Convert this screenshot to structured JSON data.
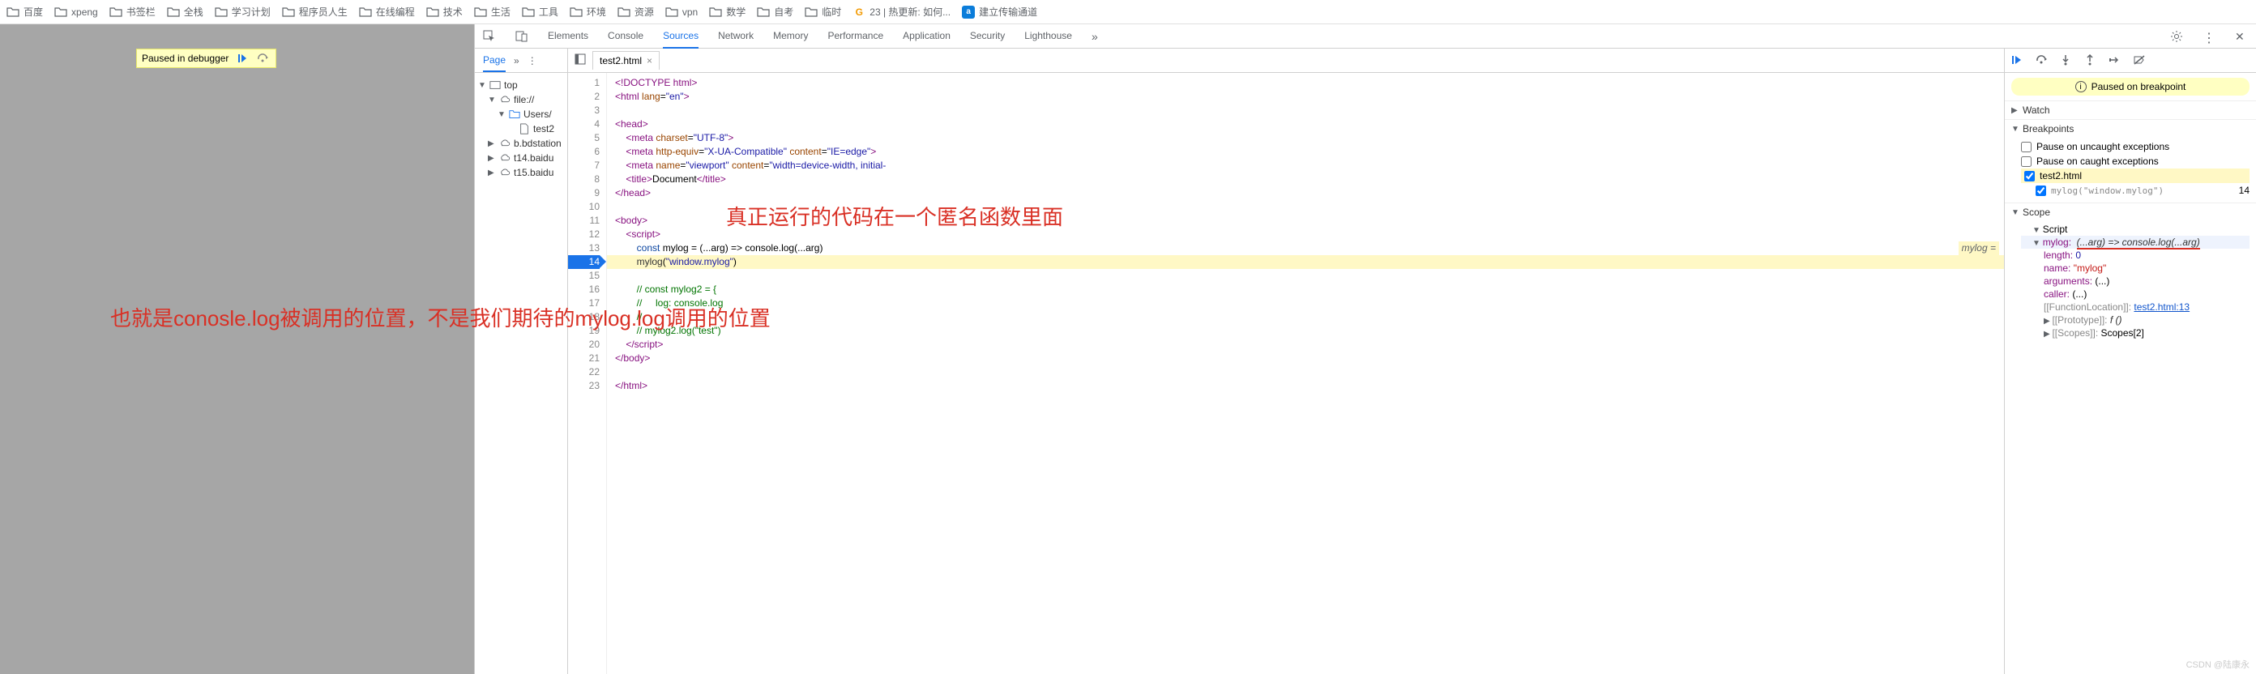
{
  "bookmarks": [
    {
      "icon": "folder",
      "label": "百度"
    },
    {
      "icon": "folder",
      "label": "xpeng"
    },
    {
      "icon": "folder",
      "label": "书签栏"
    },
    {
      "icon": "folder",
      "label": "全栈"
    },
    {
      "icon": "folder",
      "label": "学习计划"
    },
    {
      "icon": "folder",
      "label": "程序员人生"
    },
    {
      "icon": "folder",
      "label": "在线编程"
    },
    {
      "icon": "folder",
      "label": "技术"
    },
    {
      "icon": "folder",
      "label": "生活"
    },
    {
      "icon": "folder",
      "label": "工具"
    },
    {
      "icon": "folder",
      "label": "环境"
    },
    {
      "icon": "folder",
      "label": "资源"
    },
    {
      "icon": "folder",
      "label": "vpn"
    },
    {
      "icon": "folder",
      "label": "数学"
    },
    {
      "icon": "folder",
      "label": "自考"
    },
    {
      "icon": "folder",
      "label": "临时"
    },
    {
      "icon": "g",
      "label": "23 | 热更新: 如何..."
    },
    {
      "icon": "a",
      "label": "建立传输通道"
    }
  ],
  "paused_badge": "Paused in debugger",
  "annotation1": "真正运行的代码在一个匿名函数里面",
  "annotation2": "也就是conosle.log被调用的位置，不是我们期待的mylog.log调用的位置",
  "devtools_tabs": [
    "Elements",
    "Console",
    "Sources",
    "Network",
    "Memory",
    "Performance",
    "Application",
    "Security",
    "Lighthouse"
  ],
  "devtools_active_tab": "Sources",
  "page_panel": {
    "tab": "Page"
  },
  "file_tree": {
    "top": "top",
    "file": "file://",
    "users": "Users/",
    "test2": "test2",
    "bdstation": "b.bdstation",
    "t14": "t14.baidu",
    "t15": "t15.baidu"
  },
  "open_file": "test2.html",
  "code_lines": [
    {
      "n": 1,
      "html": "<span class='t-tag'>&lt;!DOCTYPE html&gt;</span>"
    },
    {
      "n": 2,
      "html": "<span class='t-tag'>&lt;html</span> <span class='t-attr'>lang</span>=<span class='t-str'>\"en\"</span><span class='t-tag'>&gt;</span>"
    },
    {
      "n": 3,
      "html": ""
    },
    {
      "n": 4,
      "html": "<span class='t-tag'>&lt;head&gt;</span>"
    },
    {
      "n": 5,
      "html": "    <span class='t-tag'>&lt;meta</span> <span class='t-attr'>charset</span>=<span class='t-str'>\"UTF-8\"</span><span class='t-tag'>&gt;</span>"
    },
    {
      "n": 6,
      "html": "    <span class='t-tag'>&lt;meta</span> <span class='t-attr'>http-equiv</span>=<span class='t-str'>\"X-UA-Compatible\"</span> <span class='t-attr'>content</span>=<span class='t-str'>\"IE=edge\"</span><span class='t-tag'>&gt;</span>"
    },
    {
      "n": 7,
      "html": "    <span class='t-tag'>&lt;meta</span> <span class='t-attr'>name</span>=<span class='t-str'>\"viewport\"</span> <span class='t-attr'>content</span>=<span class='t-str'>\"width=device-width, initial-</span>"
    },
    {
      "n": 8,
      "html": "    <span class='t-tag'>&lt;title&gt;</span>Document<span class='t-tag'>&lt;/title&gt;</span>"
    },
    {
      "n": 9,
      "html": "<span class='t-tag'>&lt;/head&gt;</span>"
    },
    {
      "n": 10,
      "html": ""
    },
    {
      "n": 11,
      "html": "<span class='t-tag'>&lt;body&gt;</span>"
    },
    {
      "n": 12,
      "html": "    <span class='t-tag'>&lt;script&gt;</span>"
    },
    {
      "n": 13,
      "html": "        <span class='t-kw'>const</span> mylog = (...arg) =&gt; console.log(...arg)",
      "hint": "mylog ="
    },
    {
      "n": 14,
      "html": "        <span class='t-call'>mylog</span>(<span class='t-str'>\"window.mylog\"</span>)",
      "hl": true,
      "bp": true
    },
    {
      "n": 15,
      "html": ""
    },
    {
      "n": 16,
      "html": "        <span class='t-com'>// const mylog2 = {</span>"
    },
    {
      "n": 17,
      "html": "        <span class='t-com'>//     log: console.log</span>"
    },
    {
      "n": 18,
      "html": "        <span class='t-com'>//</span>"
    },
    {
      "n": 19,
      "html": "        <span class='t-com'>// mylog2.log(\"test\")</span>"
    },
    {
      "n": 20,
      "html": "    <span class='t-tag'>&lt;/script&gt;</span>"
    },
    {
      "n": 21,
      "html": "<span class='t-tag'>&lt;/body&gt;</span>"
    },
    {
      "n": 22,
      "html": ""
    },
    {
      "n": 23,
      "html": "<span class='t-tag'>&lt;/html&gt;</span>"
    }
  ],
  "debug": {
    "paused_msg": "Paused on breakpoint",
    "watch": "Watch",
    "breakpoints": "Breakpoints",
    "pause_uncaught": "Pause on uncaught exceptions",
    "pause_caught": "Pause on caught exceptions",
    "bp_file": "test2.html",
    "bp_code": "mylog(\"window.mylog\")",
    "bp_line": "14",
    "scope": "Scope",
    "script": "Script",
    "mylog_label": "mylog:",
    "mylog_sig": "(...arg) => console.log(...arg)",
    "length": "length: ",
    "length_val": "0",
    "name": "name: ",
    "name_val": "\"mylog\"",
    "arguments": "arguments: ",
    "arguments_val": "(...)",
    "caller": "caller: ",
    "caller_val": "(...)",
    "func_loc": "[[FunctionLocation]]: ",
    "func_loc_val": "test2.html:13",
    "prototype": "[[Prototype]]: ",
    "prototype_val": "f ()",
    "scopes": "[[Scopes]]: ",
    "scopes_val": "Scopes[2]"
  },
  "watermark": "CSDN @陆康永"
}
